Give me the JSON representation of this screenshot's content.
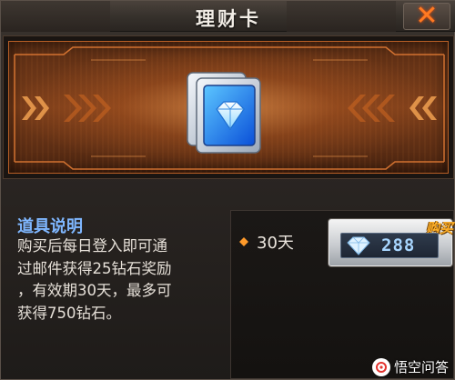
{
  "dialog": {
    "title": "理财卡",
    "close_label": "✕"
  },
  "banner": {
    "item_icon": "diamond-card-icon",
    "accent_color": "#d8742e"
  },
  "description": {
    "heading": "道具说明",
    "lines": [
      "购买后每日登入即可通",
      "过邮件获得25钻石奖励",
      "，有效期30天，最多可",
      "获得750钻石。"
    ]
  },
  "purchase": {
    "duration": "30天",
    "buy_label": "购买",
    "price": "288",
    "currency_icon": "diamond-icon"
  },
  "watermark": {
    "text": "悟空问答"
  }
}
